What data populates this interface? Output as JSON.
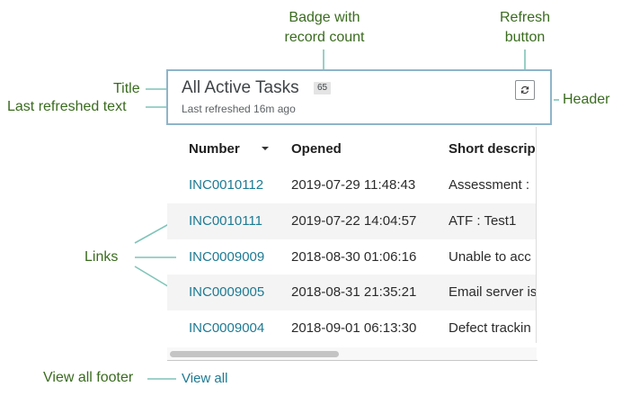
{
  "annotations": {
    "badge_callout_line1": "Badge with",
    "badge_callout_line2": "record count",
    "refresh_callout_line1": "Refresh",
    "refresh_callout_line2": "button",
    "title_callout": "Title",
    "last_refreshed_callout": "Last refreshed text",
    "header_callout": "Header",
    "links_callout": "Links",
    "view_all_footer_callout": "View all footer",
    "color": "#3a6b1f",
    "line_color": "#7fc4b8"
  },
  "widget": {
    "title": "All Active Tasks",
    "record_count": "65",
    "last_refreshed": "Last refreshed 16m ago",
    "refresh_icon": "refresh-icon",
    "border_color": "#8fb4c9"
  },
  "table": {
    "columns": {
      "number": "Number",
      "opened": "Opened",
      "short_description": "Short descrip"
    },
    "sort_icon": "caret-down-icon",
    "rows": [
      {
        "number": "INC0010112",
        "opened": "2019-07-29 11:48:43",
        "short_description": "Assessment :"
      },
      {
        "number": "INC0010111",
        "opened": "2019-07-22 14:04:57",
        "short_description": "ATF : Test1"
      },
      {
        "number": "INC0009009",
        "opened": "2018-08-30 01:06:16",
        "short_description": "Unable to acc"
      },
      {
        "number": "INC0009005",
        "opened": "2018-08-31 21:35:21",
        "short_description": "Email server is"
      },
      {
        "number": "INC0009004",
        "opened": "2018-09-01 06:13:30",
        "short_description": "Defect trackin"
      }
    ],
    "link_color": "#1d7a93"
  },
  "footer": {
    "view_all": "View all"
  }
}
